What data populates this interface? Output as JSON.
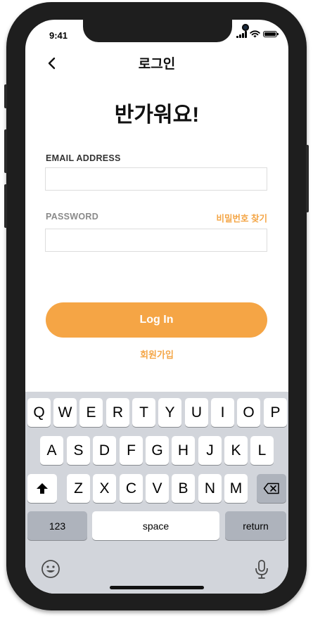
{
  "status_bar": {
    "time": "9:41"
  },
  "nav": {
    "title": "로그인",
    "back_icon": "chevron-left-icon"
  },
  "headline": "반가워요!",
  "form": {
    "email_label": "EMAIL ADDRESS",
    "email_value": "",
    "password_label": "PASSWORD",
    "password_value": "",
    "forgot_password": "비밀번호 찾기",
    "login_button": "Log In",
    "signup_link": "회원가입"
  },
  "keyboard": {
    "row1": [
      "Q",
      "W",
      "E",
      "R",
      "T",
      "Y",
      "U",
      "I",
      "O",
      "P"
    ],
    "row2": [
      "A",
      "S",
      "D",
      "F",
      "G",
      "H",
      "J",
      "K",
      "L"
    ],
    "row3": [
      "Z",
      "X",
      "C",
      "V",
      "B",
      "N",
      "M"
    ],
    "numbers_key": "123",
    "space_key": "space",
    "return_key": "return",
    "shift_icon": "shift-icon",
    "backspace_icon": "backspace-icon",
    "emoji_icon": "emoji-icon",
    "mic_icon": "microphone-icon"
  },
  "colors": {
    "accent": "#f5a545",
    "keyboard_bg": "#d2d5db",
    "frame": "#1e1e1e"
  }
}
